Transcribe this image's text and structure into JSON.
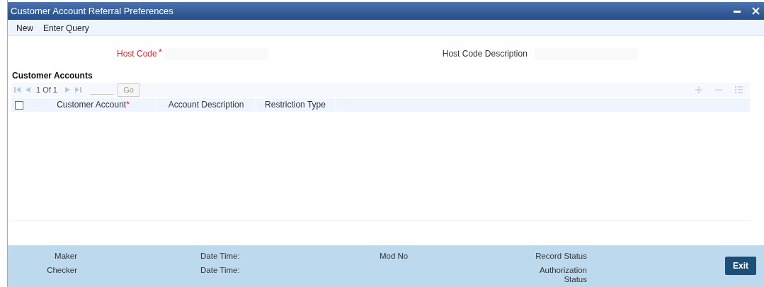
{
  "window": {
    "title": "Customer Account Referral Preferences"
  },
  "menu": [
    {
      "label": "New"
    },
    {
      "label": "Enter Query"
    }
  ],
  "fields": [
    {
      "label": "Host Code",
      "required": true,
      "required_mark": "*"
    },
    {
      "label": "Host Code Description",
      "required": false
    }
  ],
  "section_title": "Customer Accounts",
  "pager": {
    "position": "1 Of 1",
    "go": "Go"
  },
  "table": {
    "select_all_checked": false,
    "columns": [
      {
        "label": "Customer Account",
        "required_mark": "*"
      },
      {
        "label": "Account Description"
      },
      {
        "label": "Restriction Type"
      }
    ]
  },
  "footer": {
    "columns": [
      {
        "top": "Maker",
        "bottom": "Checker"
      },
      {
        "top": "Date Time:",
        "bottom": "Date Time:"
      },
      {
        "top": "Mod No"
      },
      {
        "top": "Record Status",
        "bottom": "Authorization Status"
      }
    ],
    "exit": "Exit"
  }
}
